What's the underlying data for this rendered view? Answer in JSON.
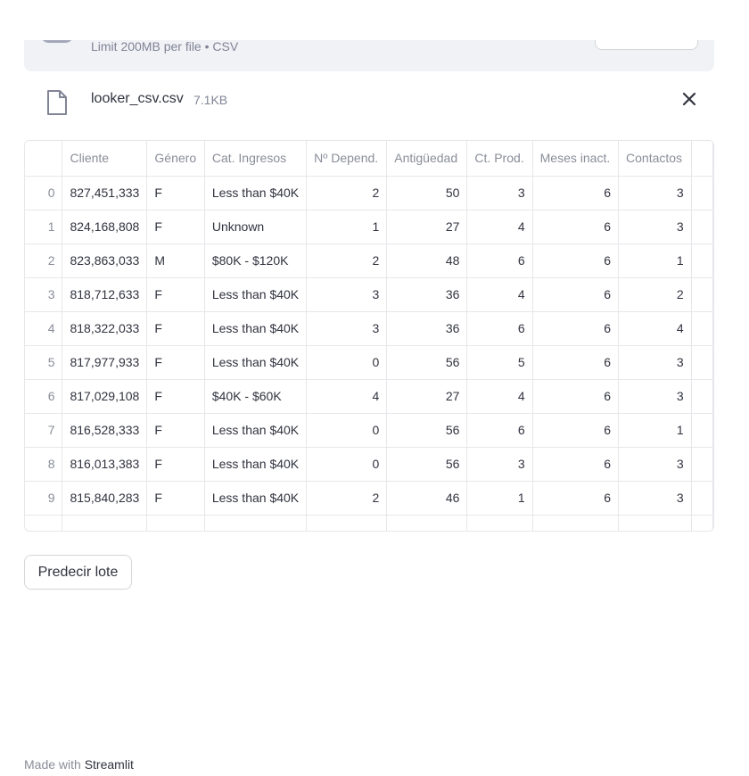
{
  "uploader": {
    "limit_text": "Limit 200MB per file • CSV"
  },
  "file": {
    "name": "looker_csv.csv",
    "size": "7.1KB"
  },
  "table": {
    "columns": [
      "",
      "Cliente",
      "Género",
      "Cat. Ingresos",
      "Nº Depend.",
      "Antigüedad",
      "Ct. Prod.",
      "Meses inact.",
      "Contactos"
    ],
    "rows": [
      [
        "0",
        "827,451,333",
        "F",
        "Less than $40K",
        "2",
        "50",
        "3",
        "6",
        "3"
      ],
      [
        "1",
        "824,168,808",
        "F",
        "Unknown",
        "1",
        "27",
        "4",
        "6",
        "3"
      ],
      [
        "2",
        "823,863,033",
        "M",
        "$80K - $120K",
        "2",
        "48",
        "6",
        "6",
        "1"
      ],
      [
        "3",
        "818,712,633",
        "F",
        "Less than $40K",
        "3",
        "36",
        "4",
        "6",
        "2"
      ],
      [
        "4",
        "818,322,033",
        "F",
        "Less than $40K",
        "3",
        "36",
        "6",
        "6",
        "4"
      ],
      [
        "5",
        "817,977,933",
        "F",
        "Less than $40K",
        "0",
        "56",
        "5",
        "6",
        "3"
      ],
      [
        "6",
        "817,029,108",
        "F",
        "$40K - $60K",
        "4",
        "27",
        "4",
        "6",
        "3"
      ],
      [
        "7",
        "816,528,333",
        "F",
        "Less than $40K",
        "0",
        "56",
        "6",
        "6",
        "1"
      ],
      [
        "8",
        "816,013,383",
        "F",
        "Less than $40K",
        "0",
        "56",
        "3",
        "6",
        "3"
      ],
      [
        "9",
        "815,840,283",
        "F",
        "Less than $40K",
        "2",
        "46",
        "1",
        "6",
        "3"
      ]
    ]
  },
  "button": {
    "label": "Predecir lote"
  },
  "footer": {
    "prefix": "Made with ",
    "brand": "Streamlit"
  },
  "icons": {
    "file": "file-icon",
    "close": "close-icon"
  }
}
